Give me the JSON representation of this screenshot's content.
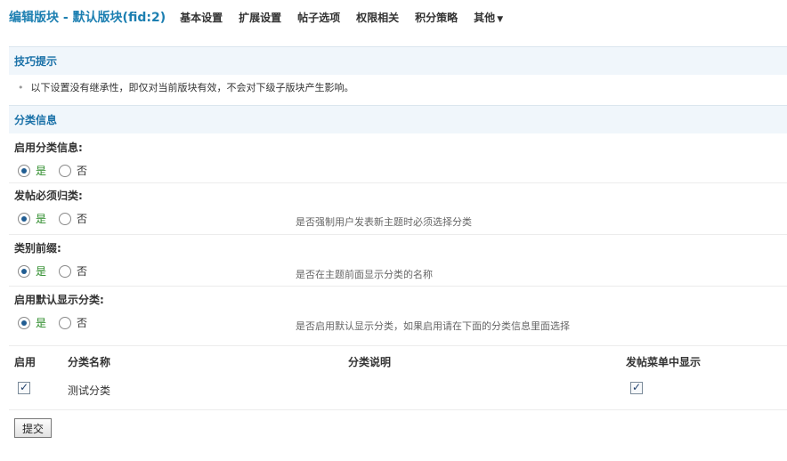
{
  "header": {
    "title": "编辑版块 - 默认版块(fid:2)",
    "nav": [
      {
        "label": "基本设置"
      },
      {
        "label": "扩展设置"
      },
      {
        "label": "帖子选项"
      },
      {
        "label": "权限相关"
      },
      {
        "label": "积分策略"
      },
      {
        "label": "其他",
        "arrow": "▼"
      }
    ]
  },
  "tips": {
    "title": "技巧提示",
    "text": "以下设置没有继承性，即仅对当前版块有效，不会对下级子版块产生影响。",
    "bullet": "•"
  },
  "category_info": {
    "title": "分类信息",
    "settings": [
      {
        "label": "启用分类信息:",
        "yes": "是",
        "no": "否",
        "selected": "yes",
        "desc": ""
      },
      {
        "label": "发帖必须归类:",
        "yes": "是",
        "no": "否",
        "selected": "yes",
        "desc": "是否强制用户发表新主题时必须选择分类"
      },
      {
        "label": "类别前缀:",
        "yes": "是",
        "no": "否",
        "selected": "yes",
        "desc": "是否在主题前面显示分类的名称"
      },
      {
        "label": "启用默认显示分类:",
        "yes": "是",
        "no": "否",
        "selected": "yes",
        "desc": "是否启用默认显示分类，如果启用请在下面的分类信息里面选择"
      }
    ]
  },
  "table": {
    "headers": {
      "enable": "启用",
      "name": "分类名称",
      "desc": "分类说明",
      "menu": "发帖菜单中显示"
    },
    "rows": [
      {
        "enabled": true,
        "name": "测试分类",
        "desc": "",
        "in_menu": true
      }
    ]
  },
  "submit_label": "提交",
  "colors": {
    "title": "#1c7fb1",
    "section": "#1a71a8",
    "yes": "#2a8a27",
    "section_bg": "#f0f6fb"
  }
}
